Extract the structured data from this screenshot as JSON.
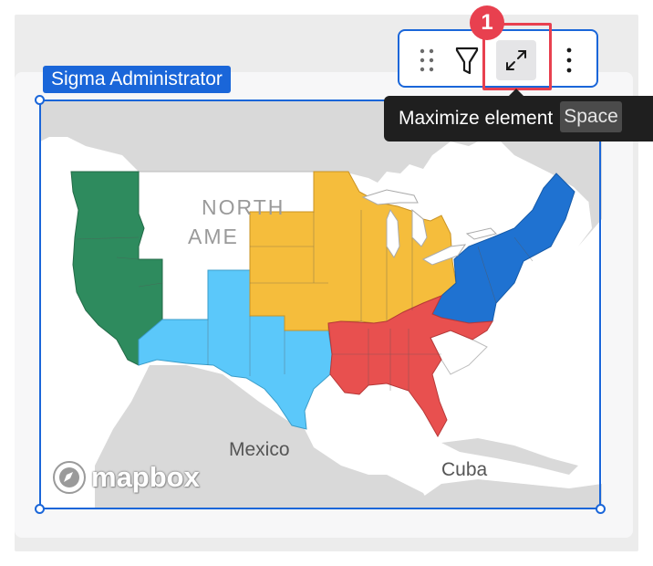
{
  "element": {
    "owner_label": "Sigma Administrator"
  },
  "toolbar": {
    "drag_icon": "drag-handle-icon",
    "filter_icon": "filter-icon",
    "maximize_icon": "maximize-icon",
    "more_icon": "more-vertical-icon"
  },
  "tooltip": {
    "label": "Maximize element",
    "shortcut": "Space"
  },
  "callout": {
    "number": "1",
    "color": "#e8404f"
  },
  "map": {
    "labels": {
      "continent_line1": "NORTH",
      "continent_line2": "AME",
      "country_mexico": "Mexico",
      "country_cuba": "Cuba"
    },
    "attribution": "mapbox",
    "region_colors": {
      "west": "#2e8b5e",
      "midwest": "#f5bd3c",
      "mountain": "#5bc8fa",
      "northeast": "#1f72d1",
      "southeast": "#e8504f",
      "land": "#d9d9d9",
      "water": "#ffffff"
    }
  },
  "colors": {
    "accent": "#1a66d9",
    "tooltip_bg": "#1f1f1f"
  }
}
